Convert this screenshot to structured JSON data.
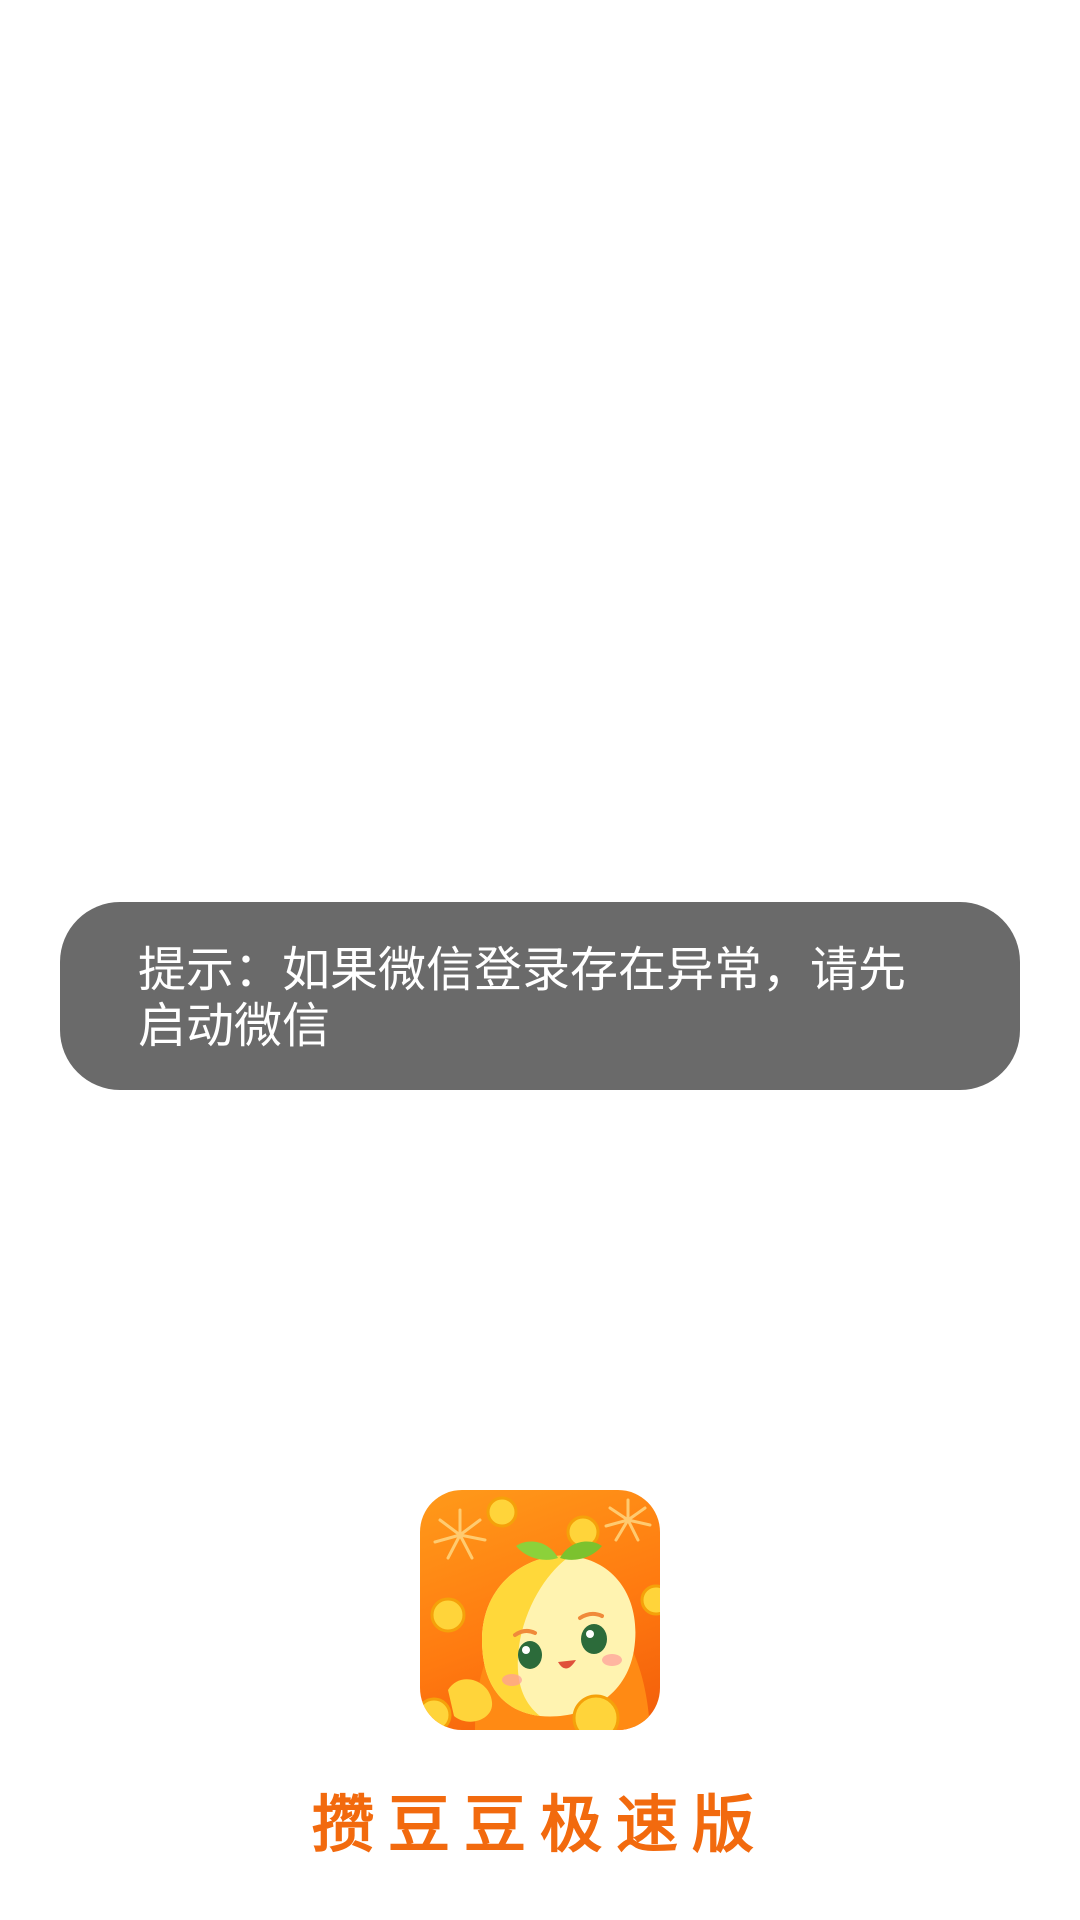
{
  "toast": {
    "message": "提示：如果微信登录存在异常，请先启动微信"
  },
  "app": {
    "icon": "mascot-app-icon",
    "name": "攒豆豆极速版",
    "brand_color": "#f26a0e",
    "icon_bg_color": "#ff8a14"
  }
}
